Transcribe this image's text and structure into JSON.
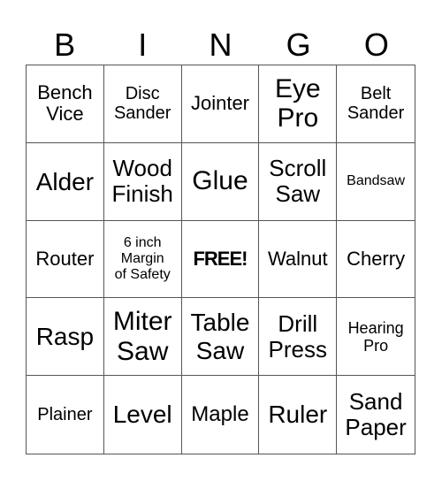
{
  "header": {
    "letters": [
      "B",
      "I",
      "N",
      "G",
      "O"
    ]
  },
  "cells": [
    "Bench Vice",
    "Disc Sander",
    "Jointer",
    "Eye Pro",
    "Belt Sander",
    "Alder",
    "Wood Finish",
    "Glue",
    "Scroll Saw",
    "Bandsaw",
    "Router",
    "6 inch Margin of Safety",
    "FREE!",
    "Walnut",
    "Cherry",
    "Rasp",
    "Miter Saw",
    "Table Saw",
    "Drill Press",
    "Hearing Pro",
    "Plainer",
    "Level",
    "Maple",
    "Ruler",
    "Sand Paper"
  ],
  "cells_lines": [
    [
      "Bench",
      "Vice"
    ],
    [
      "Disc",
      "Sander"
    ],
    [
      "Jointer"
    ],
    [
      "Eye",
      "Pro"
    ],
    [
      "Belt",
      "Sander"
    ],
    [
      "Alder"
    ],
    [
      "Wood",
      "Finish"
    ],
    [
      "Glue"
    ],
    [
      "Scroll",
      "Saw"
    ],
    [
      "Bandsaw"
    ],
    [
      "Router"
    ],
    [
      "6 inch",
      "Margin",
      "of Safety"
    ],
    [
      "FREE!"
    ],
    [
      "Walnut"
    ],
    [
      "Cherry"
    ],
    [
      "Rasp"
    ],
    [
      "Miter",
      "Saw"
    ],
    [
      "Table",
      "Saw"
    ],
    [
      "Drill",
      "Press"
    ],
    [
      "Hearing",
      "Pro"
    ],
    [
      "Plainer"
    ],
    [
      "Level"
    ],
    [
      "Maple"
    ],
    [
      "Ruler"
    ],
    [
      "Sand",
      "Paper"
    ]
  ]
}
